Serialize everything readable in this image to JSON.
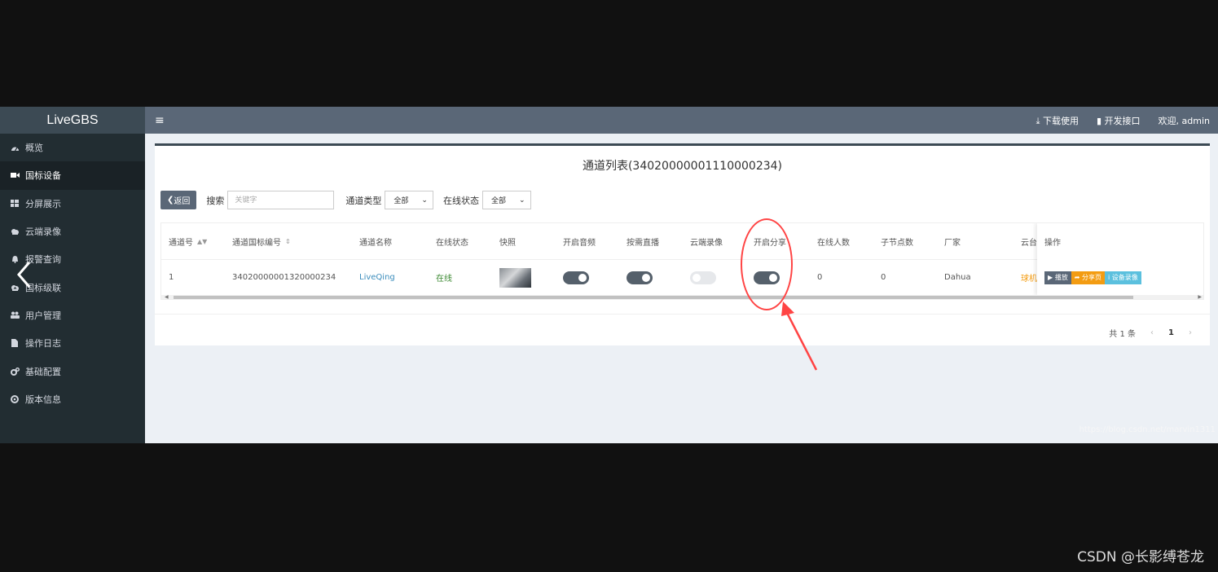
{
  "app": {
    "logo": "LiveGBS"
  },
  "sidebar": {
    "items": [
      {
        "icon": "dashboard-icon",
        "label": "概览"
      },
      {
        "icon": "video-camera-icon",
        "label": "国标设备",
        "active": true
      },
      {
        "icon": "grid-icon",
        "label": "分屏展示"
      },
      {
        "icon": "cloud-icon",
        "label": "云端录像"
      },
      {
        "icon": "bell-icon",
        "label": "报警查询"
      },
      {
        "icon": "cloud-upload-icon",
        "label": "国标级联"
      },
      {
        "icon": "users-icon",
        "label": "用户管理"
      },
      {
        "icon": "file-icon",
        "label": "操作日志"
      },
      {
        "icon": "gears-icon",
        "label": "基础配置"
      },
      {
        "icon": "info-circle-icon",
        "label": "版本信息"
      }
    ]
  },
  "topbar": {
    "hamburger_icon": "hamburger-icon",
    "download": "下载使用",
    "api": "开发接口",
    "welcome": "欢迎, admin"
  },
  "panel": {
    "title": "通道列表(34020000001110000234)",
    "back_label": "返回",
    "search_label": "搜索",
    "search_placeholder": "关键字",
    "channel_type_label": "通道类型",
    "channel_type_value": "全部",
    "online_status_label": "在线状态",
    "online_status_value": "全部"
  },
  "table": {
    "headers": [
      "通道号",
      "通道国标编号",
      "通道名称",
      "在线状态",
      "快照",
      "开启音频",
      "按需直播",
      "云端录像",
      "开启分享",
      "在线人数",
      "子节点数",
      "厂家",
      "云台",
      "操作"
    ],
    "row": {
      "channel_no": "1",
      "gb_id": "34020000001320000234",
      "name": "LiveQing",
      "status": "在线",
      "audio": true,
      "on_demand": true,
      "cloud_record": false,
      "share": true,
      "online_count": "0",
      "sub_nodes": "0",
      "vendor": "Dahua",
      "ptz": "球机",
      "actions": {
        "play": "播放",
        "share_page": "分享页",
        "device_record": "设备录像"
      }
    }
  },
  "pager": {
    "total": "共 1 条",
    "current": "1",
    "prev": "‹",
    "next": "›"
  },
  "watermark": "https://blog.csdn.net/marvin1311",
  "csdn_mark": "CSDN @长影缚苍龙",
  "colors": {
    "sidebar_bg": "#222d32",
    "topbar_bg": "#5a6777",
    "link": "#3c8dbc",
    "play_btn": "#5a6777",
    "share_btn": "#f39c12",
    "record_btn": "#5bc0de",
    "annotation": "#ff4444"
  }
}
